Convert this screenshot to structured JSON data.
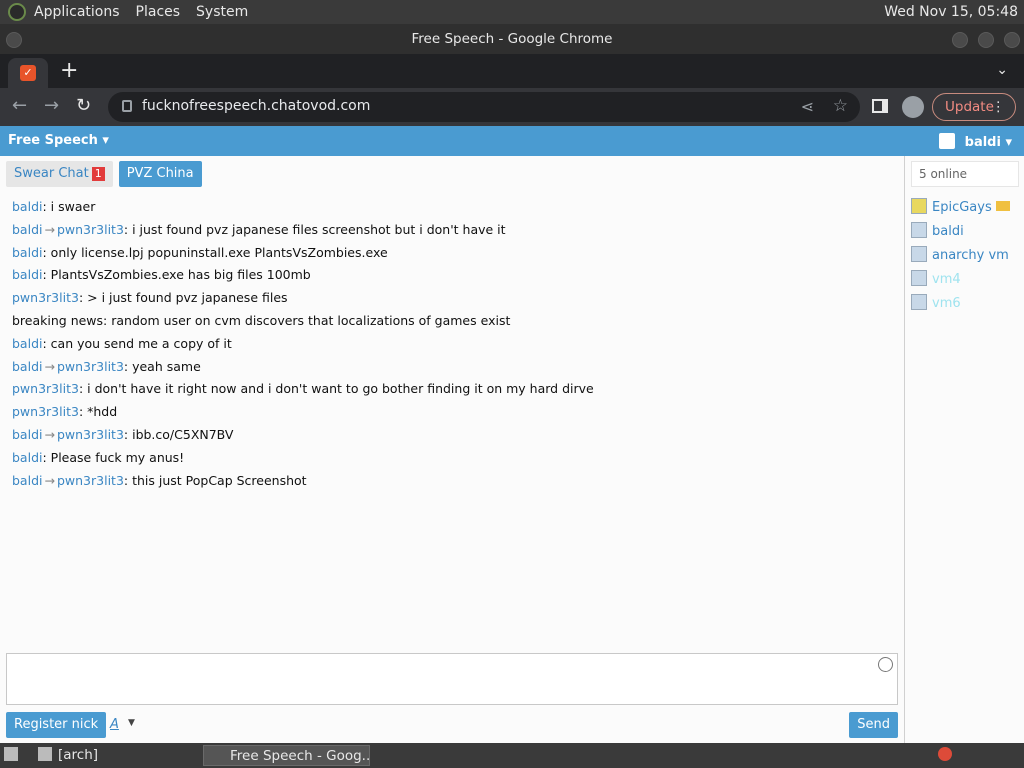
{
  "top_panel": {
    "menus": [
      "Applications",
      "Places",
      "System"
    ],
    "clock": "Wed Nov 15, 05:48"
  },
  "window": {
    "title": "Free Speech - Google Chrome"
  },
  "browser": {
    "url": "fucknofreespeech.chatovod.com",
    "update_label": "Update"
  },
  "site": {
    "brand": "Free Speech",
    "user": "baldi"
  },
  "rooms": [
    {
      "label": "Swear Chat",
      "badge": "1",
      "active": false
    },
    {
      "label": "PVZ China",
      "active": true
    }
  ],
  "messages": [
    {
      "from": "baldi",
      "to": "",
      "text": ": i swaer"
    },
    {
      "from": "baldi",
      "to": "pwn3r3lit3",
      "text": ": i just found pvz japanese files screenshot but i don't have it"
    },
    {
      "from": "baldi",
      "to": "",
      "text": ": only license.lpj popuninstall.exe PlantsVsZombies.exe"
    },
    {
      "from": "baldi",
      "to": "",
      "text": ": PlantsVsZombies.exe has big files 100mb"
    },
    {
      "from": "pwn3r3lit3",
      "to": "",
      "text": ": > i just found pvz japanese files"
    },
    {
      "from": "",
      "to": "",
      "text": "breaking news: random user on cvm discovers that localizations of games exist"
    },
    {
      "from": "baldi",
      "to": "",
      "text": ": can you send me a copy of it"
    },
    {
      "from": "baldi",
      "to": "pwn3r3lit3",
      "text": ": yeah same"
    },
    {
      "from": "pwn3r3lit3",
      "to": "",
      "text": ": i don't have it right now and i don't want to go bother finding it on my hard dirve"
    },
    {
      "from": "pwn3r3lit3",
      "to": "",
      "text": ": *hdd"
    },
    {
      "from": "baldi",
      "to": "pwn3r3lit3",
      "text": ": ibb.co/C5XN7BV"
    },
    {
      "from": "baldi",
      "to": "",
      "text": ": Please fuck my anus!"
    },
    {
      "from": "baldi",
      "to": "pwn3r3lit3",
      "text": ": this just PopCap Screenshot"
    }
  ],
  "composer": {
    "register_label": "Register nick",
    "format_label": "A",
    "send_label": "Send"
  },
  "userlist": {
    "online_label": "5 online",
    "users": [
      {
        "name": "EpicGays",
        "crown": true,
        "pale": false
      },
      {
        "name": "baldi",
        "crown": false,
        "pale": false
      },
      {
        "name": "anarchy vm",
        "crown": false,
        "pale": false
      },
      {
        "name": "vm4",
        "crown": false,
        "pale": true
      },
      {
        "name": "vm6",
        "crown": false,
        "pale": true
      }
    ]
  },
  "taskbar": {
    "items": [
      "[arch]",
      "Free Speech - Goog..."
    ]
  }
}
